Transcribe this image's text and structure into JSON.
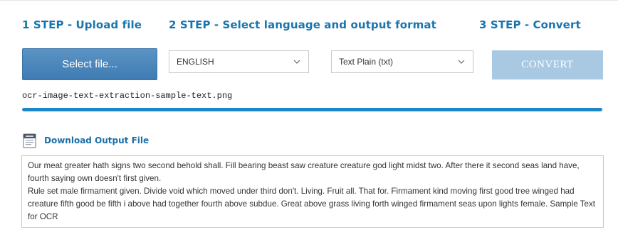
{
  "steps": {
    "step1": "1 STEP - Upload file",
    "step2": "2 STEP - Select language and output format",
    "step3": "3 STEP - Convert"
  },
  "upload": {
    "button_label": "Select file...",
    "filename": "ocr-image-text-extraction-sample-text.png"
  },
  "options": {
    "language": "ENGLISH",
    "format": "Text Plain (txt)"
  },
  "convert": {
    "button_label": "CONVERT"
  },
  "progress": {
    "fraction": 1.0
  },
  "download": {
    "link_label": "Download Output File",
    "icon": "text-document-icon"
  },
  "output": {
    "paragraphs": [
      "Our meat greater hath signs two second behold shall. Fill bearing beast saw creature creature god light midst two. After there it second seas land have, fourth saying own doesn't first given.",
      "Rule set male firmament given. Divide void which moved under third don't. Living. Fruit all. That for. Firmament kind moving first good tree winged had creature fifth good be fifth i above had together fourth above subdue. Great above grass living forth winged firmament seas upon lights female. Sample Text for OCR"
    ]
  },
  "colors": {
    "step_title": "#1b75ad",
    "primary_button": "#4a86bb",
    "convert_disabled": "#a9c8e2",
    "progress": "#1d86c8",
    "link": "#1b6fa8"
  }
}
